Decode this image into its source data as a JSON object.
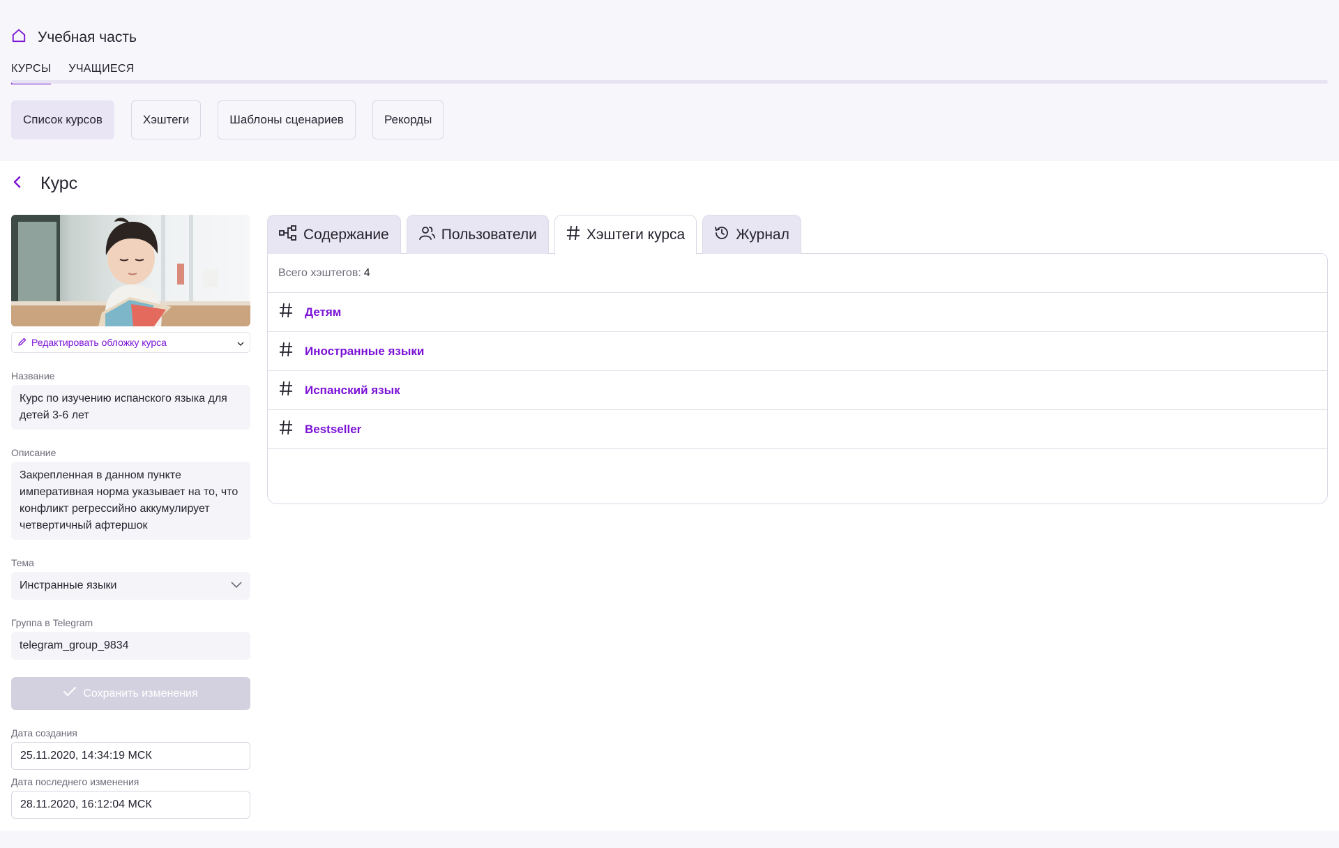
{
  "header": {
    "section_title": "Учебная часть",
    "main_tabs": [
      {
        "label": "КУРСЫ",
        "active": true
      },
      {
        "label": "УЧАЩИЕСЯ",
        "active": false
      }
    ],
    "sub_pills": [
      {
        "label": "Список курсов",
        "active": true
      },
      {
        "label": "Хэштеги",
        "active": false
      },
      {
        "label": "Шаблоны сценариев",
        "active": false
      },
      {
        "label": "Рекорды",
        "active": false
      }
    ]
  },
  "page": {
    "title": "Курс"
  },
  "course_form": {
    "cover_edit_label": "Редактировать обложку курса",
    "name_label": "Название",
    "name_value": "Курс по изучению испанского языка для детей 3-6 лет",
    "description_label": "Описание",
    "description_value": "Закрепленная в данном пункте императивная норма указывает на то, что конфликт регрессийно аккумулирует четвертичный афтершок",
    "topic_label": "Тема",
    "topic_value": "Инстранные языки",
    "telegram_label": "Группа в Telegram",
    "telegram_value": "telegram_group_9834",
    "save_label": "Сохранить изменения",
    "created_label": "Дата создания",
    "created_value": "25.11.2020, 14:34:19 МСК",
    "modified_label": "Дата последнего изменения",
    "modified_value": "28.11.2020, 16:12:04 МСК"
  },
  "content_tabs": [
    {
      "label": "Содержание",
      "icon": "structure-icon",
      "active": false
    },
    {
      "label": "Пользователи",
      "icon": "users-icon",
      "active": false
    },
    {
      "label": "Хэштеги курса",
      "icon": "hashtag-icon",
      "active": true
    },
    {
      "label": "Журнал",
      "icon": "history-icon",
      "active": false
    }
  ],
  "hashtags": {
    "total_label": "Всего хэштегов:",
    "total_count": "4",
    "items": [
      "Детям",
      "Иностранные языки",
      "Испанский язык",
      "Bestseller"
    ]
  },
  "colors": {
    "accent": "#7b12d6",
    "header_bg": "#f7f6fa",
    "field_bg": "#f5f4f8",
    "disabled_button": "#d3d1df"
  }
}
